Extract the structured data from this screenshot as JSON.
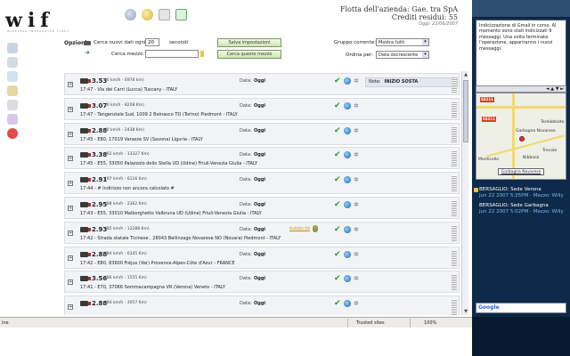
{
  "header": {
    "logo_text": "wif",
    "logo_subtitle": "WIRELESS INTEGRATED FLEET",
    "fleet_name": "Flotta dell'azienda: Gae. tra SpA",
    "credits": "Crediti residui: 55",
    "date": "Oggi: 22/06/2007"
  },
  "options": {
    "title": "Opzioni",
    "refresh_label": "Cerca nuovi dati ogni:",
    "refresh_value": "20",
    "refresh_unit": "secondi",
    "search_label": "Cerca mezzo:",
    "search_value": "",
    "save_button": "Salva impostazioni",
    "find_button": "Cerca questo mezzo",
    "group_label": "Gruppo corrente:",
    "group_value": "Mostra tutti",
    "order_label": "Ordina per:",
    "order_value": "Data decrescente"
  },
  "rows": [
    {
      "speed": "3.53",
      "kmh": "(0 km/h - 6978 km)",
      "addr": "17:47 - Via dei Carri (Lucca) Tuscany - ITALY",
      "date_label": "Data:",
      "date": "Oggi",
      "autista": "",
      "note_label": "Note:",
      "note": "INIZIO SOSTA"
    },
    {
      "speed": "3.07",
      "kmh": "(0 km/h - 8208 Km)",
      "addr": "17:47 - Tangenziale Sud, 1009 2 Beinasco TO (Torino) Piedmont - ITALY",
      "date_label": "Data:",
      "date": "Oggi",
      "autista": "",
      "note_label": "",
      "note": ""
    },
    {
      "speed": "2.88",
      "kmh": "(0 km/h - 2438 Km)",
      "addr": "17:45 - E80, 17019 Varazze SV (Savona) Liguria - ITALY",
      "date_label": "Data:",
      "date": "Oggi",
      "autista": "",
      "note_label": "",
      "note": ""
    },
    {
      "speed": "3.38",
      "kmh": "(92 km/h - 13327 Km)",
      "addr": "17:45 - E55, 33050 Palazzolo dello Stella UD (Udine) Friuli-Venezia Giulia - ITALY",
      "date_label": "Data:",
      "date": "Oggi",
      "autista": "",
      "note_label": "",
      "note": ""
    },
    {
      "speed": "2.91",
      "kmh": "(97 km/h - 6116 Km)",
      "addr": "17:44 - # Indirizzo non ancora calcolato #",
      "date_label": "Data:",
      "date": "Oggi",
      "autista": "",
      "note_label": "",
      "note": ""
    },
    {
      "speed": "2.95",
      "kmh": "(88 km/h - 2362 Km)",
      "addr": "17:43 - E55, 33010 Malborghetto Valbruna UD (Udine) Friuli-Venezia Giulia - ITALY",
      "date_label": "Data:",
      "date": "Oggi",
      "autista": "",
      "note_label": "",
      "note": ""
    },
    {
      "speed": "2.93",
      "kmh": "(85 km/h - 12288 Km)",
      "addr": "17:42 - Strada statale Ticinese , 28043 Bellinzago Novarese NO (Novara) Piedmont - ITALY",
      "date_label": "Data:",
      "date": "Oggi",
      "autista": "Autista 04",
      "note_label": "",
      "note": ""
    },
    {
      "speed": "2.88",
      "kmh": "(84 km/h - 6345 Km)",
      "addr": "17:42 - E80, 83600 Fréjus (Var) Provence-Alpes-Côte d'Azur - FRANCE",
      "date_label": "Data:",
      "date": "Oggi",
      "autista": "",
      "note_label": "",
      "note": ""
    },
    {
      "speed": "3.56",
      "kmh": "(86 km/h - 1555 Km)",
      "addr": "17:41 - E70, 37066 Sommacampagna VR (Verona) Veneto - ITALY",
      "date_label": "Data:",
      "date": "Oggi",
      "autista": "",
      "note_label": "",
      "note": ""
    },
    {
      "speed": "2.88",
      "kmh": "(84 km/h - 3057 Km)",
      "addr": "",
      "date_label": "Data:",
      "date": "Oggi",
      "autista": "",
      "note_label": "",
      "note": ""
    }
  ],
  "status": {
    "left": "ine",
    "trusted": "Trusted sites",
    "zoom": "100%"
  },
  "gadgets": {
    "gmail_text": "Indicizzazione di Gmail in corso. Al momento sono stati indicizzati 9 messaggi. Una volta terminata l'operazione, appariranno i nuovi messaggi.",
    "map_controls": "◄ ▲ ▼ ►",
    "map_places": [
      "Garbagna Novarese",
      "Nibbiola",
      "Terdobbiate",
      "Monticello",
      "Trecate"
    ],
    "map_highway": "SS211",
    "map_label": "Garbagna Novarese",
    "alerts": [
      {
        "title": "BERSAGLIO: Sede Verona",
        "meta": "Jun 22 2007 5:35PM - Mezzo: Willy"
      },
      {
        "title": "BERSAGLIO: Sede Garbagna",
        "meta": "Jun 22 2007 5:02PM - Mezzo: Willy"
      }
    ],
    "search_brand": "Google"
  }
}
